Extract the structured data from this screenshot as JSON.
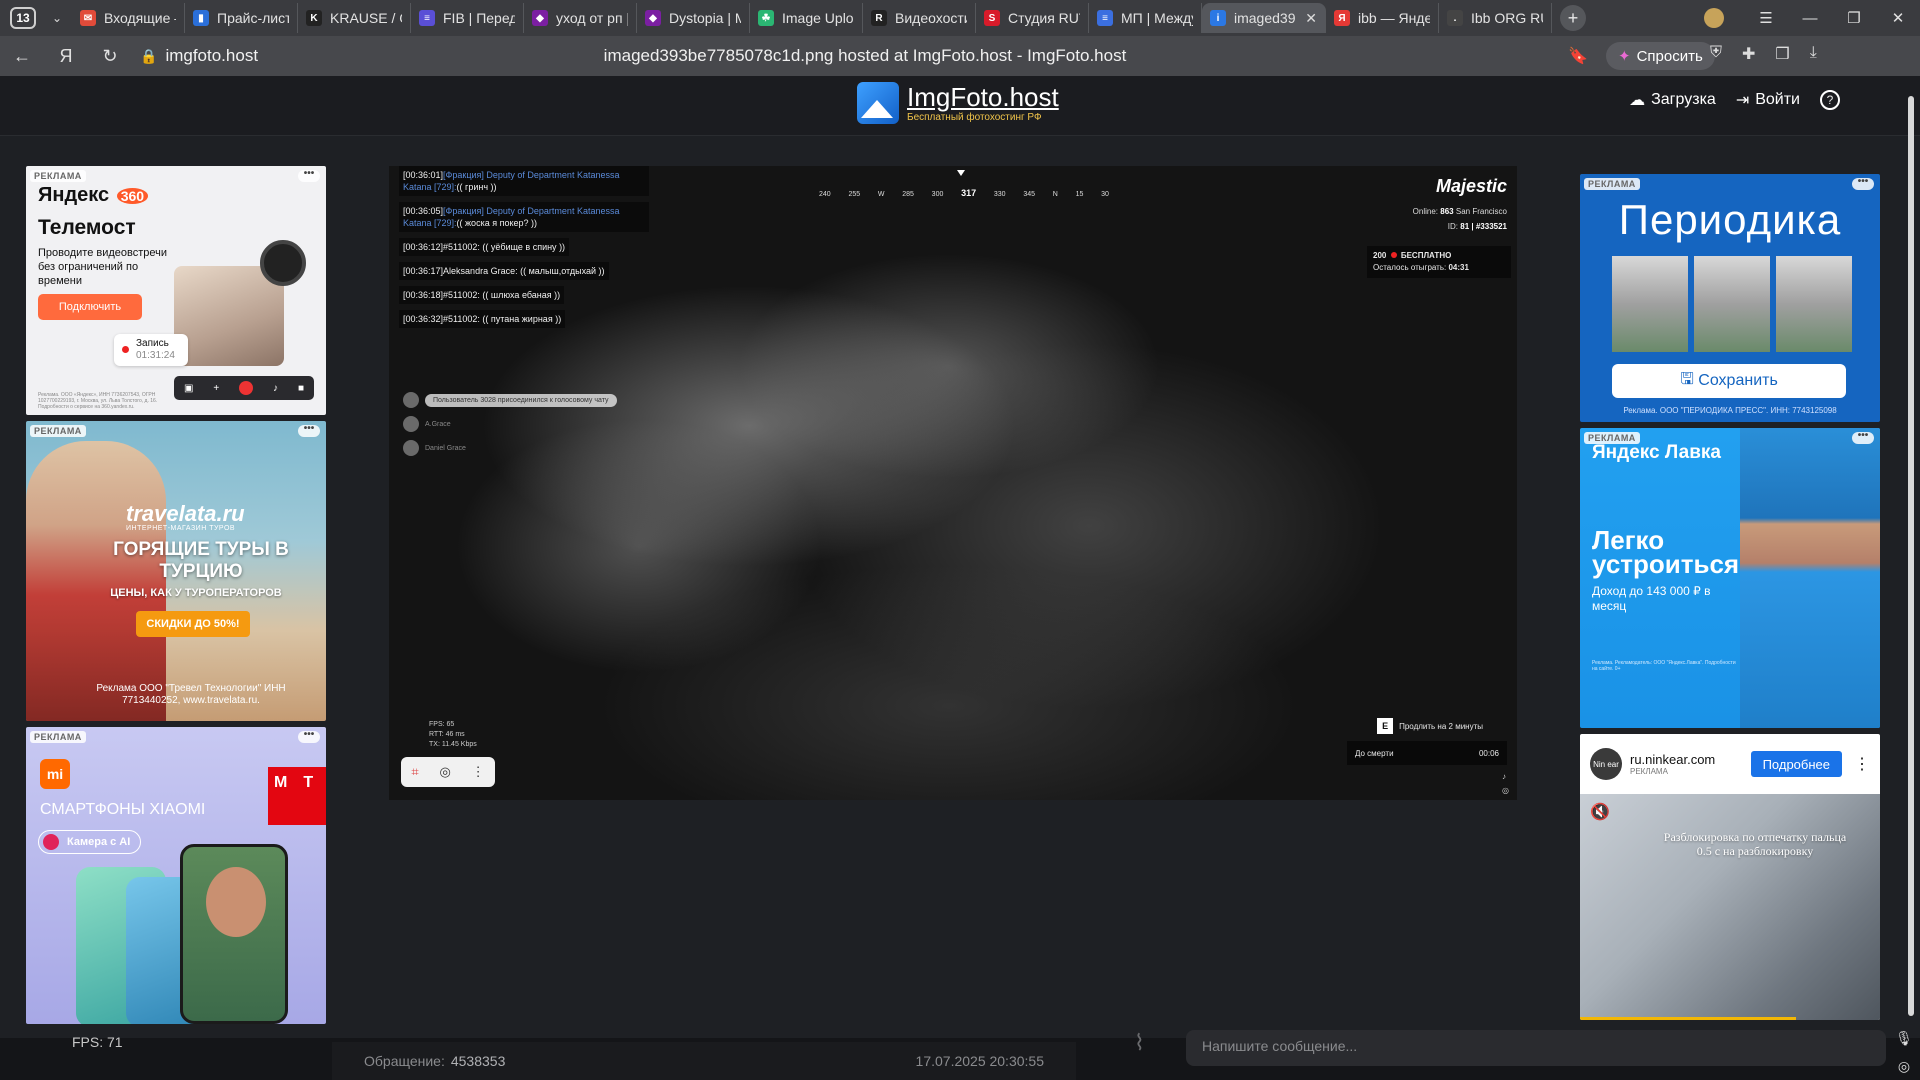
{
  "browser": {
    "tab_count": "13",
    "tabs": [
      {
        "title": "Входящие –",
        "fav_color": "#e14b3a",
        "fav_glyph": "✉"
      },
      {
        "title": "Прайс-лист",
        "fav_color": "#2b6fd9",
        "fav_glyph": "▮"
      },
      {
        "title": "KRAUSE / G",
        "fav_color": "#222222",
        "fav_glyph": "K"
      },
      {
        "title": "FIB | Переда",
        "fav_color": "#5a4fd6",
        "fav_glyph": "≡"
      },
      {
        "title": "уход от рп |",
        "fav_color": "#7b1fa2",
        "fav_glyph": "◆"
      },
      {
        "title": "Dystopia | M",
        "fav_color": "#7b1fa2",
        "fav_glyph": "◆"
      },
      {
        "title": "Image Uploa",
        "fav_color": "#2bb673",
        "fav_glyph": "☘"
      },
      {
        "title": "Видеохости",
        "fav_color": "#222222",
        "fav_glyph": "R"
      },
      {
        "title": "Студия RUT",
        "fav_color": "#d81b2a",
        "fav_glyph": "S"
      },
      {
        "title": "МП | Между",
        "fav_color": "#3b6fe0",
        "fav_glyph": "≡"
      },
      {
        "title": "imaged39",
        "fav_color": "#2b78e4",
        "fav_glyph": "i",
        "active": true
      },
      {
        "title": "ibb — Яндек",
        "fav_color": "#e53935",
        "fav_glyph": "Я"
      },
      {
        "title": "Ibb ORG RU",
        "fav_color": "#444444",
        "fav_glyph": "."
      }
    ],
    "close_glyph": "✕",
    "new_tab_glyph": "+",
    "window_controls": {
      "menu": "☰",
      "minimize": "—",
      "restore": "❐",
      "close": "✕"
    },
    "address": {
      "domain": "imgfoto.host",
      "page_title": "imaged393be7785078c1d.png hosted at ImgFoto.host - ImgFoto.host",
      "ask_label": "Спросить"
    }
  },
  "site": {
    "logo_name": "ImgFoto.host",
    "logo_sub": "Бесплатный фотохостинг РФ",
    "upload_label": "Загрузка",
    "login_label": "Войти",
    "help_glyph": "?"
  },
  "ads": {
    "badge": "РЕКЛАМА",
    "more": "•••",
    "yandex360": {
      "brand_a": "Яндекс",
      "brand_num": "360",
      "headline": "Телемост",
      "desc": "Проводите видеовстречи без ограничений по времени",
      "cta": "Подключить",
      "rec_label": "Запись",
      "rec_time": "01:31:24",
      "legal": "Реклама. ООО «Яндекс», ИНН 7736207543, ОГРН 1027700229193, г. Москва, ул. Льва Толстого, д. 16. Подробности о сервисе на 360.yandex.ru."
    },
    "travelata": {
      "logo": "travelata.ru",
      "logo_sub": "ИНТЕРНЕТ-МАГАЗИН ТУРОВ",
      "headline": "ГОРЯЩИЕ ТУРЫ В ТУРЦИЮ",
      "sub": "ЦЕНЫ, КАК У ТУРОПЕРАТОРОВ",
      "cta": "СКИДКИ ДО 50%!",
      "legal": "Реклама ООО \"Тревел Технологии\" ИНН 7713440252, www.travelata.ru."
    },
    "xiaomi": {
      "mi": "mi",
      "mts": "МТС",
      "headline": "СМАРТФОНЫ XIAOMI",
      "pill": "Камера с AI"
    },
    "periodika": {
      "headline": "Периодика",
      "cta": "Сохранить",
      "legal": "Реклама. ООО \"ПЕРИОДИКА ПРЕСС\". ИНН: 7743125098"
    },
    "lavka": {
      "brand": "Яндекс Лавка",
      "headline": "Легко устроиться",
      "sub": "Доход до 143 000 ₽ в месяц",
      "legal": "Реклама. Рекламодатель: ООО \"Яндекс.Лавка\". Подробности на сайте. 0+"
    },
    "ninkear": {
      "avatar": "Nin ear",
      "domain": "ru.ninkear.com",
      "label": "РЕКЛАМА",
      "cta": "Подробнее",
      "menu": "⋮",
      "mute_glyph": "🔇",
      "caption": "Разблокировка по отпечатку пальца",
      "caption_sub": "0.5 с на разблокировку",
      "progress": 0.72
    }
  },
  "screenshot": {
    "chat": [
      {
        "time": "[00:36:01]",
        "faction": "[Фракция] Deputy of Department Katanessa Katana [729]:",
        "text": "(( гринч ))"
      },
      {
        "time": "[00:36:05]",
        "faction": "[Фракция] Deputy of Department Katanessa Katana [729]:",
        "text": "(( жоска я покер? ))"
      },
      {
        "time": "[00:36:12]",
        "faction": "",
        "text": "#511002: (( уёбище в спину ))"
      },
      {
        "time": "[00:36:17]",
        "faction": "",
        "text": "Aleksandra Grace: (( малыш,отдыхай ))"
      },
      {
        "time": "[00:36:18]",
        "faction": "",
        "text": "#511002: (( шлюха ебаная ))"
      },
      {
        "time": "[00:36:32]",
        "faction": "",
        "text": "#511002: (( путана жирная ))"
      }
    ],
    "voice": [
      {
        "text": "Пользователь 3028 присоединился к голосовому чату",
        "style": "hl"
      },
      {
        "text": "A.Grace",
        "style": "dim"
      },
      {
        "text": "Daniel Grace",
        "style": "dim"
      }
    ],
    "compass_ticks": [
      "240",
      "255",
      "W",
      "285",
      "300",
      "317",
      "330",
      "345",
      "N",
      "15",
      "30"
    ],
    "compass_current": "317",
    "server_brand": "Majestic",
    "online_label": "Online:",
    "online_value": "863",
    "server_city": "San Francisco",
    "id_label": "ID:",
    "id_value": "81 | #333521",
    "free_count": "200",
    "free_label": "БЕСПЛАТНО",
    "free_left_label": "Осталось отыграть:",
    "free_left_value": "04:31",
    "stats": [
      {
        "k": "FPS:",
        "v": "65"
      },
      {
        "k": "RTT:",
        "v": "46 ms"
      },
      {
        "k": "TX:",
        "v": "11.45 Kbps"
      }
    ],
    "tool_icons": {
      "crop": "⌗",
      "camera": "◎",
      "more": "⋮"
    },
    "extend_key": "E",
    "extend_label": "Продлить на 2 минуты",
    "death_label": "До смерти",
    "death_value": "00:06"
  },
  "page_bottom": {
    "fps": "FPS: 71",
    "ticket_label": "Обращение:",
    "ticket_value": "4538353",
    "ticket_date": "17.07.2025 20:30:55",
    "message_placeholder": "Напишите сообщение..."
  }
}
